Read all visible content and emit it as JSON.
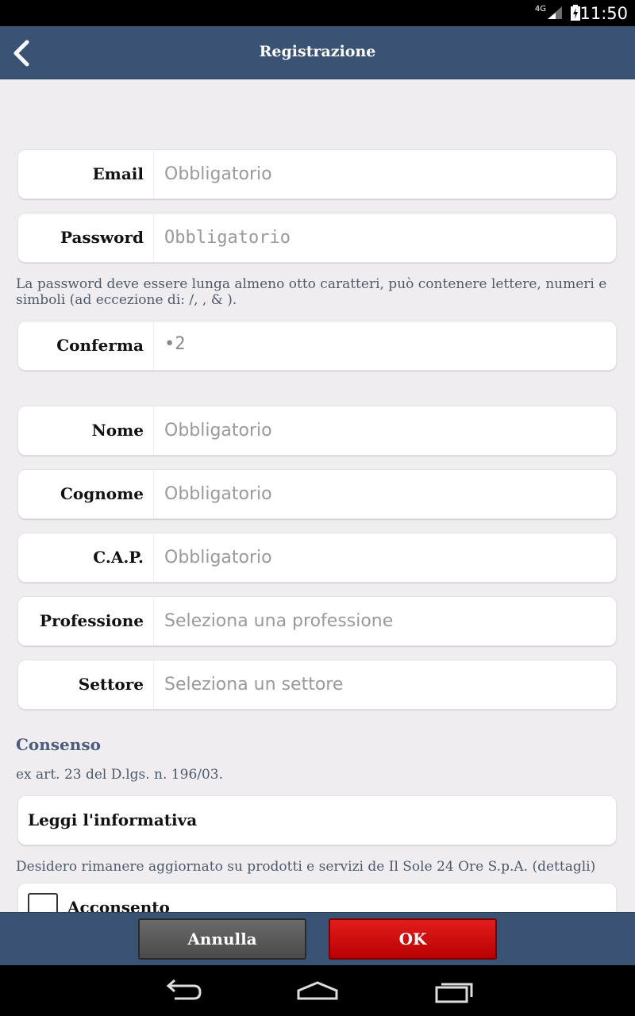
{
  "status": {
    "network": "4G",
    "time": "11:50"
  },
  "appbar": {
    "title": "Registrazione",
    "back_icon": "back-chevron-icon"
  },
  "form": {
    "email": {
      "label": "Email",
      "placeholder": "Obbligatorio"
    },
    "password": {
      "label": "Password",
      "placeholder": "Obbligatorio"
    },
    "password_hint": "La password deve essere lunga almeno otto caratteri, può contenere lettere, numeri e simboli (ad eccezione di: /, , & ).",
    "confirm": {
      "label": "Conferma",
      "value": "•2"
    },
    "nome": {
      "label": "Nome",
      "placeholder": "Obbligatorio"
    },
    "cognome": {
      "label": "Cognome",
      "placeholder": "Obbligatorio"
    },
    "cap": {
      "label": "C.A.P.",
      "placeholder": "Obbligatorio"
    },
    "professione": {
      "label": "Professione",
      "placeholder": "Seleziona una professione"
    },
    "settore": {
      "label": "Settore",
      "placeholder": "Seleziona un settore"
    }
  },
  "consent": {
    "title": "Consenso",
    "subtitle": "ex art. 23 del D.lgs. n. 196/03.",
    "info_link": "Leggi l'informativa",
    "updates_text": "Desidero rimanere aggiornato su prodotti e servizi de Il Sole 24 Ore S.p.A. (dettagli)",
    "checkbox_label": "Acconsento"
  },
  "actions": {
    "cancel_label": "Annulla",
    "ok_label": "OK"
  },
  "colors": {
    "header": "#3a5374",
    "ok": "#d40000",
    "cancel": "#5a5a5a",
    "background": "#efedef"
  }
}
